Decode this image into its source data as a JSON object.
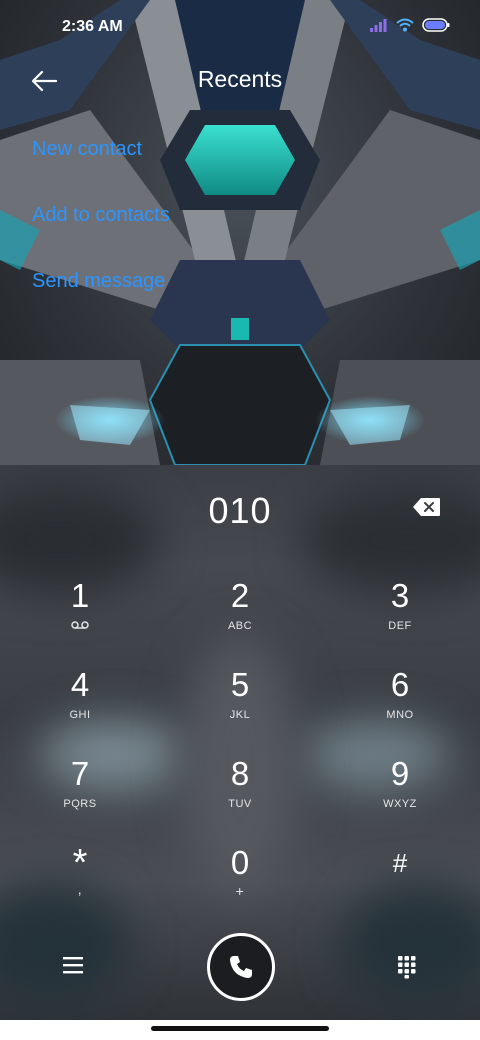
{
  "status_bar": {
    "time": "2:36 AM"
  },
  "header": {
    "title": "Recents"
  },
  "menu": [
    {
      "label": "New contact"
    },
    {
      "label": "Add to contacts"
    },
    {
      "label": "Send message"
    }
  ],
  "dialpad": {
    "number": "010",
    "keys": [
      {
        "digit": "1",
        "letters": ""
      },
      {
        "digit": "2",
        "letters": "ABC"
      },
      {
        "digit": "3",
        "letters": "DEF"
      },
      {
        "digit": "4",
        "letters": "GHI"
      },
      {
        "digit": "5",
        "letters": "JKL"
      },
      {
        "digit": "6",
        "letters": "MNO"
      },
      {
        "digit": "7",
        "letters": "PQRS"
      },
      {
        "digit": "8",
        "letters": "TUV"
      },
      {
        "digit": "9",
        "letters": "WXYZ"
      },
      {
        "digit": "*",
        "letters": ","
      },
      {
        "digit": "0",
        "letters": "+"
      },
      {
        "digit": "#",
        "letters": ""
      }
    ]
  },
  "icons": {
    "back": "back-arrow-icon",
    "backspace": "backspace-icon",
    "voicemail": "voicemail-icon",
    "menu": "hamburger-menu-icon",
    "call": "phone-icon",
    "keypad": "keypad-grid-icon"
  },
  "colors": {
    "accent": "#2d95ff",
    "teal": "#2ad1c4"
  }
}
